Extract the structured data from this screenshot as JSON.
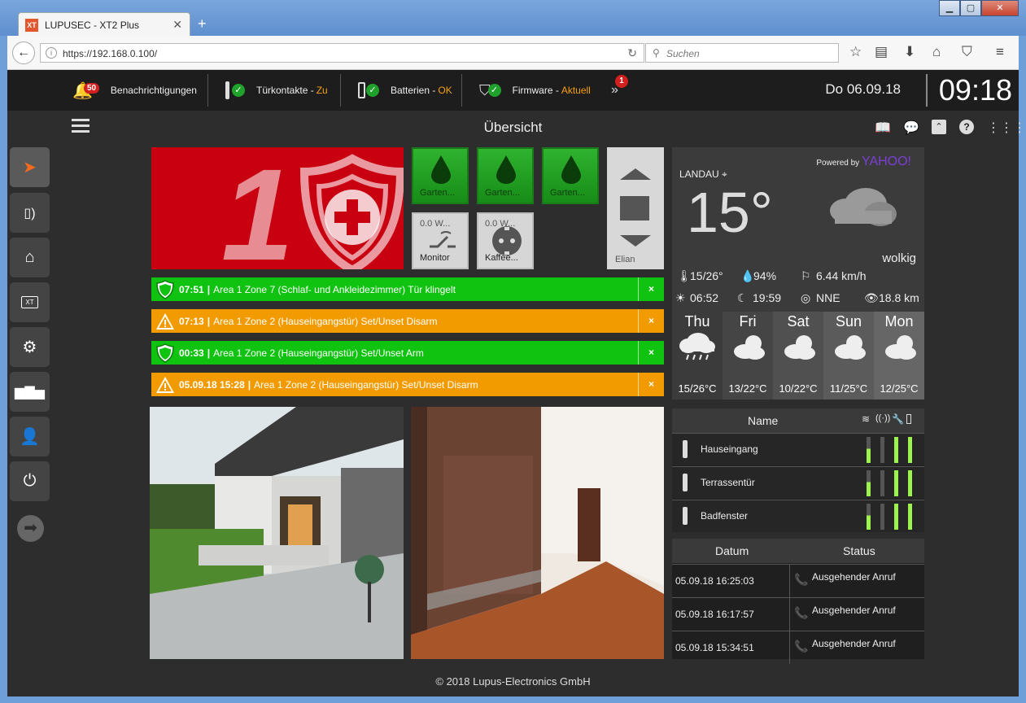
{
  "browser": {
    "tab_title": "LUPUSEC - XT2 Plus",
    "tab_favicon": "XT",
    "url": "https://192.168.0.100/",
    "search_placeholder": "Suchen"
  },
  "topbar": {
    "notifications_label": "Benachrichtigungen",
    "notifications_count": "50",
    "contacts_label": "Türkontakte - ",
    "contacts_status": "Zu",
    "batteries_label": "Batterien - ",
    "batteries_status": "OK",
    "firmware_label": "Firmware - ",
    "firmware_status": "Aktuell",
    "more_count": "1",
    "date": "Do 06.09.18",
    "time": "09:18"
  },
  "page_title": "Übersicht",
  "alarm": {
    "area": "1"
  },
  "tiles": [
    {
      "label": "Garten...",
      "value": ""
    },
    {
      "label": "Garten...",
      "value": ""
    },
    {
      "label": "Garten...",
      "value": ""
    },
    {
      "label": "Monitor",
      "value": "0.0 W..."
    },
    {
      "label": "Kaffee...",
      "value": "0.0 W..."
    },
    {
      "label": "Elian",
      "value": ""
    }
  ],
  "events": [
    {
      "time": "07:51",
      "text": "Area 1 Zone 7 (Schlaf- und Ankleidezimmer) Tür klingelt",
      "type": "green"
    },
    {
      "time": "07:13",
      "text": "Area 1 Zone 2 (Hauseingangstür) Set/Unset Disarm",
      "type": "orange"
    },
    {
      "time": "00:33",
      "text": "Area 1 Zone 2 (Hauseingangstür) Set/Unset Arm",
      "type": "green"
    },
    {
      "time": "05.09.18 15:28",
      "text": "Area 1 Zone 2 (Hauseingangstür) Set/Unset Disarm",
      "type": "orange"
    }
  ],
  "event_sep": "|",
  "close_glyph": "×",
  "weather": {
    "powered": "Powered by",
    "provider": "YAHOO!",
    "city": "LANDAU",
    "temp": "15°",
    "condition": "wolkig",
    "minmax": "15/26°",
    "humidity": "94%",
    "wind": "6.44 km/h",
    "sunrise": "06:52",
    "sunset": "19:59",
    "direction": "NNE",
    "visibility": "18.8 km",
    "forecast": [
      {
        "day": "Thu",
        "temps": "15/26°C"
      },
      {
        "day": "Fri",
        "temps": "13/22°C"
      },
      {
        "day": "Sat",
        "temps": "10/22°C"
      },
      {
        "day": "Sun",
        "temps": "11/25°C"
      },
      {
        "day": "Mon",
        "temps": "12/25°C"
      }
    ]
  },
  "sensors": {
    "header": "Name",
    "rows": [
      {
        "name": "Hauseingang",
        "bars": [
          0.55,
          0,
          1,
          1
        ]
      },
      {
        "name": "Terrassentür",
        "bars": [
          0.55,
          0,
          1,
          1
        ]
      },
      {
        "name": "Badfenster",
        "bars": [
          0.55,
          0,
          1,
          1
        ]
      }
    ]
  },
  "calls": {
    "col_date": "Datum",
    "col_status": "Status",
    "rows": [
      {
        "date": "05.09.18 16:25:03",
        "status": "Ausgehender Anruf"
      },
      {
        "date": "05.09.18 16:17:57",
        "status": "Ausgehender Anruf"
      },
      {
        "date": "05.09.18 15:34:51",
        "status": "Ausgehender Anruf"
      }
    ]
  },
  "footer": "© 2018 Lupus-Electronics GmbH",
  "colors": {
    "green_event": "#10c310",
    "orange_event": "#f19b00",
    "alarm_red": "#c8000f",
    "accent_orange": "#f6a010"
  }
}
